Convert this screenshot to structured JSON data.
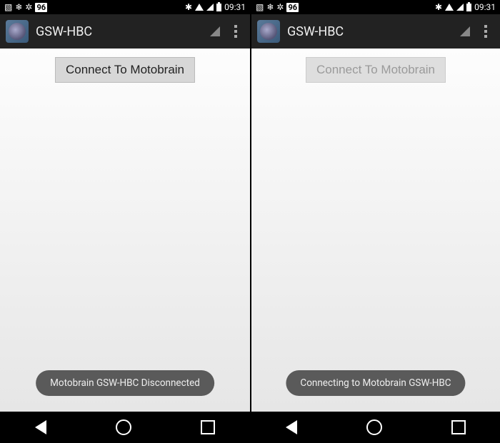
{
  "screens": [
    {
      "status_bar": {
        "battery_label": "96",
        "time": "09:31"
      },
      "action_bar": {
        "title": "GSW-HBC"
      },
      "connect_button": {
        "label": "Connect To Motobrain",
        "enabled": true
      },
      "toast": "Motobrain GSW-HBC Disconnected"
    },
    {
      "status_bar": {
        "battery_label": "96",
        "time": "09:31"
      },
      "action_bar": {
        "title": "GSW-HBC"
      },
      "connect_button": {
        "label": "Connect To Motobrain",
        "enabled": false
      },
      "toast": "Connecting to Motobrain GSW-HBC"
    }
  ]
}
